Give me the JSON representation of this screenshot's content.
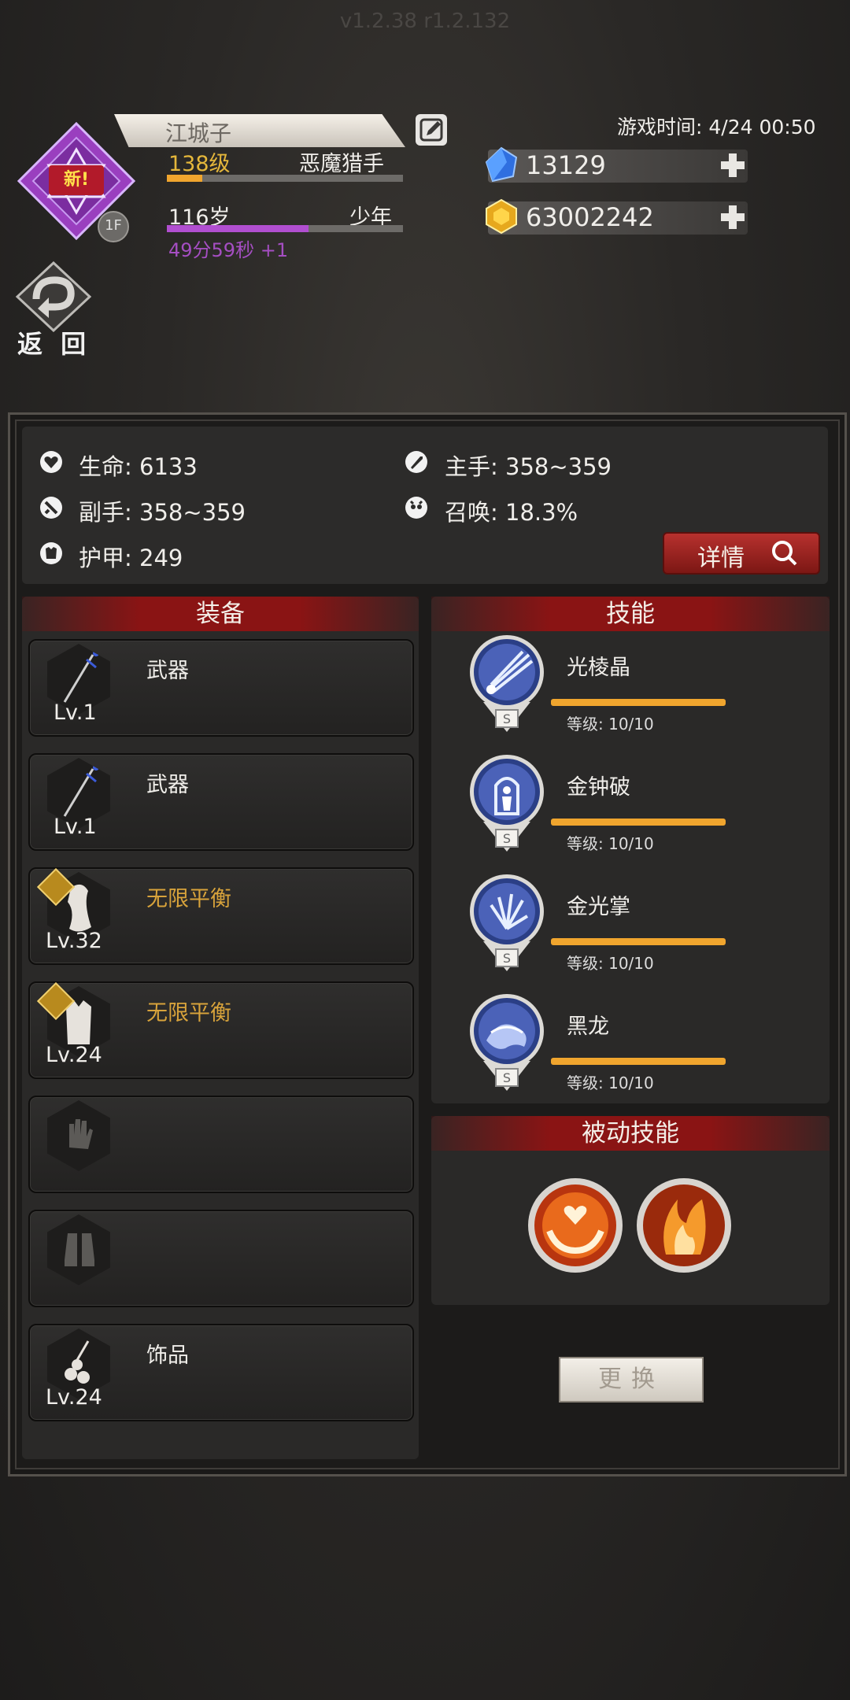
{
  "version": "v1.2.38 r1.2.132",
  "player": {
    "badge": "新!",
    "emblem_letter": "1F",
    "name": "江城子",
    "level": "138级",
    "class_name": "恶魔猎手",
    "level_progress": 0.15,
    "age": "116岁",
    "age_category": "少年",
    "age_progress": 0.6,
    "timer": "49分59秒 +1"
  },
  "back_label": "返 回",
  "game_time": "游戏时间: 4/24 00:50",
  "resources": {
    "gems": "13129",
    "gold": "63002242"
  },
  "stats": {
    "hp": "生命: 6133",
    "main_hand": "主手: 358~359",
    "off_hand": "副手: 358~359",
    "summon": "召唤: 18.3%",
    "armor": "护甲: 249",
    "details_label": "详情"
  },
  "equipment": {
    "title": "装备",
    "slots": [
      {
        "name": "武器",
        "level": "Lv.1",
        "gold": false
      },
      {
        "name": "武器",
        "level": "Lv.1",
        "gold": false
      },
      {
        "name": "无限平衡",
        "level": "Lv.32",
        "gold": true
      },
      {
        "name": "无限平衡",
        "level": "Lv.24",
        "gold": true
      },
      {
        "name": "",
        "level": "",
        "gold": false
      },
      {
        "name": "",
        "level": "",
        "gold": false
      },
      {
        "name": "饰品",
        "level": "Lv.24",
        "gold": false
      }
    ]
  },
  "skills": {
    "title": "技能",
    "items": [
      {
        "name": "光棱晶",
        "level": "等级: 10/10",
        "rank": "S",
        "progress": 1.0
      },
      {
        "name": "金钟破",
        "level": "等级: 10/10",
        "rank": "S",
        "progress": 1.0
      },
      {
        "name": "金光掌",
        "level": "等级: 10/10",
        "rank": "S",
        "progress": 1.0
      },
      {
        "name": "黑龙",
        "level": "等级: 10/10",
        "rank": "S",
        "progress": 1.0
      }
    ]
  },
  "passive": {
    "title": "被动技能"
  },
  "change_label": "更换",
  "colors": {
    "accent_red": "#8a1414",
    "gold_text": "#d8a33b",
    "bar_orange": "#f0a52e",
    "purple": "#a54ec2"
  }
}
